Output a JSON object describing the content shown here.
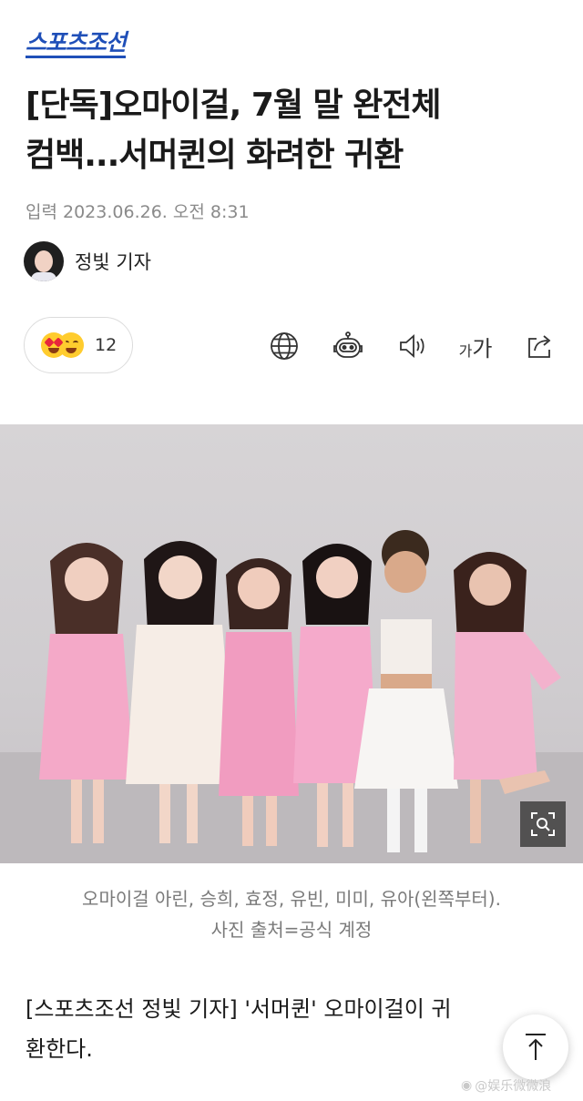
{
  "brand": {
    "logo": "스포츠조선",
    "color": "#1f4fb8"
  },
  "article": {
    "headline_line1": "[단독]오마이걸, 7월 말 완전체",
    "headline_line2": "컴백...서머퀸의 화려한 귀환",
    "date": "입력 2023.06.26. 오전 8:31",
    "reporter": "정빛 기자",
    "caption_line1": "오마이걸 아린, 승희, 효정, 유빈, 미미, 유아(왼쪽부터).",
    "caption_line2": "사진 출처=공식 계정",
    "body_line1": "[스포츠조선 정빛 기자] '서머퀸' 오마이걸이 귀",
    "body_line2": "환한다."
  },
  "reactions": {
    "count": "12",
    "emojis": [
      "heart-eyes-emoji",
      "smile-emoji"
    ]
  },
  "toolbar": {
    "icons": [
      "globe-icon",
      "robot-icon",
      "speaker-icon",
      "font-size-icon",
      "share-icon"
    ],
    "font_small": "가",
    "font_large": "가"
  },
  "photo": {
    "zoom_icon": "zoom-search-icon"
  },
  "watermark": {
    "text": "@娱乐微微浪"
  },
  "colors": {
    "accent": "#1f4fb8",
    "text": "#1a1a1a",
    "muted": "#8a8a8a"
  }
}
